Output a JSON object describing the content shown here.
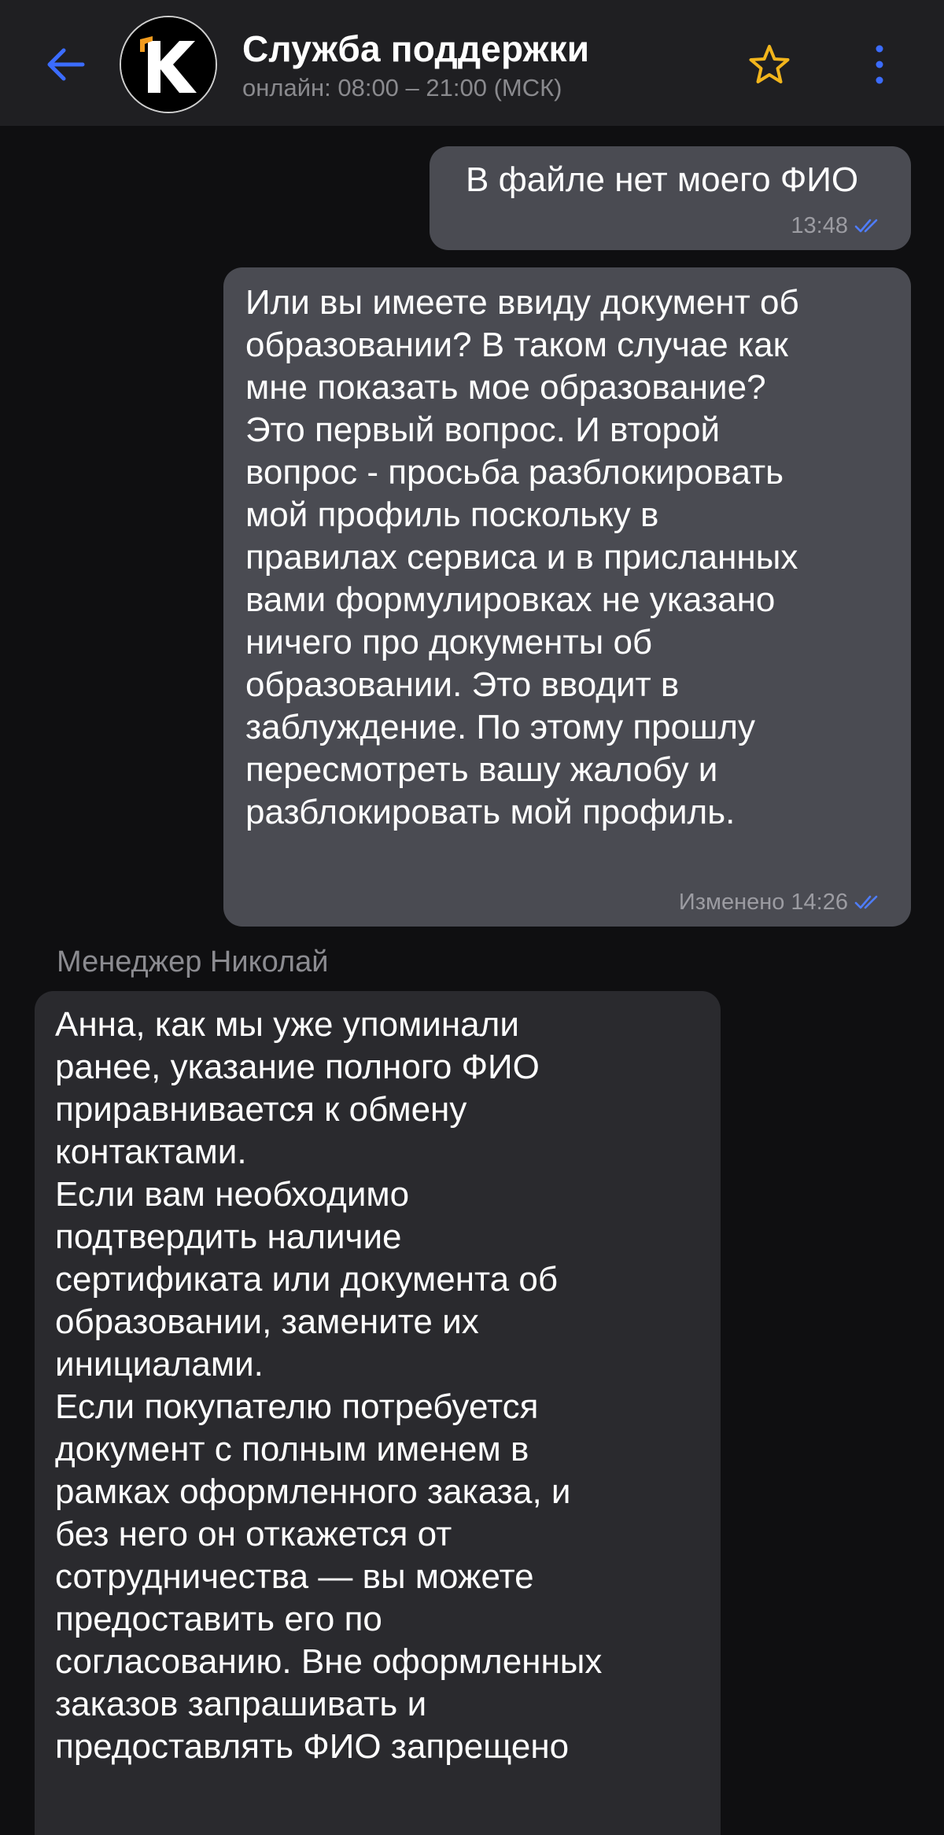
{
  "header": {
    "title": "Служба поддержки",
    "status": "онлайн: 08:00 – 21:00 (МСК)",
    "back_icon": "arrow-left-icon",
    "star_icon": "star-icon",
    "menu_icon": "more-vertical-icon",
    "accent_color": "#3b6cff",
    "star_color": "#f2b51c"
  },
  "messages": [
    {
      "direction": "out",
      "text": "В файле нет моего ФИО",
      "time": "13:48",
      "status_icon": "double-check-icon"
    },
    {
      "direction": "out",
      "text": "Или вы имеете ввиду документ об\nобразовании? В таком случае как\nмне показать мое образование?\nЭто первый вопрос. И второй\nвопрос - просьба разблокировать\nмой профиль поскольку в\nправилах сервиса и в присланных\nвами формулировках не указано\nничего про документы об\nобразовании. Это вводит в\nзаблуждение. По этому прошлу\nпересмотреть вашу жалобу и\nразблокировать мой профиль.",
      "time": "Изменено 14:26",
      "status_icon": "double-check-icon"
    },
    {
      "direction": "in",
      "sender": "Менеджер Николай",
      "text": "Анна, как мы уже упоминали\nранее, указание полного ФИО\nприравнивается к обмену\nконтактами.\nЕсли вам необходимо\nподтвердить наличие\nсертификата или документа об\nобразовании, замените их\nинициалами.\nЕсли покупателю потребуется\nдокумент с полным именем в\nрамках оформленного заказа, и\nбез него он откажется от\nсотрудничества — вы можете\nпредоставить его по\nсогласованию. Вне оформленных\nзаказов запрашивать и\nпредоставлять ФИО запрещено"
    }
  ]
}
